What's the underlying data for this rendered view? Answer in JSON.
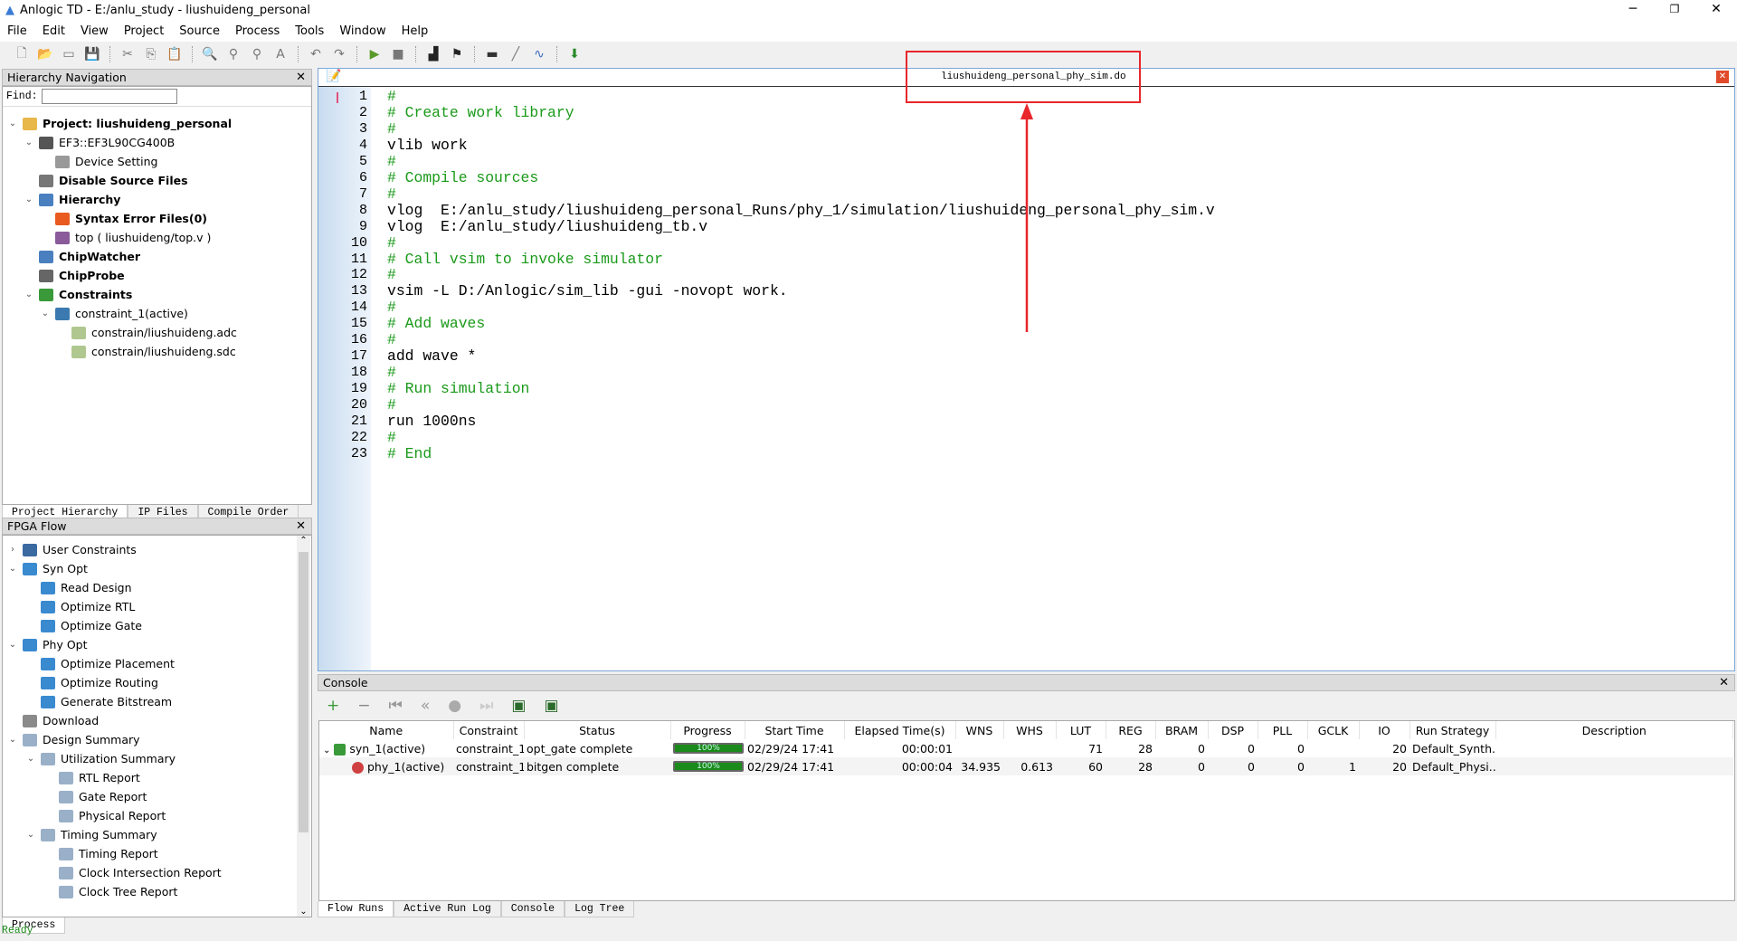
{
  "window": {
    "title": "Anlogic TD - E:/anlu_study - liushuideng_personal",
    "minimize": "─",
    "restore": "❐",
    "close": "✕"
  },
  "menu": [
    "File",
    "Edit",
    "View",
    "Project",
    "Source",
    "Process",
    "Tools",
    "Window",
    "Help"
  ],
  "toolbar": [
    "new-file",
    "open",
    "close",
    "save",
    "cut",
    "copy",
    "paste",
    "find",
    "find-prev",
    "find-next",
    "replace",
    "undo",
    "redo",
    "run",
    "stop",
    "chart",
    "flag",
    "chip",
    "probe",
    "waveform",
    "download"
  ],
  "hierarchy": {
    "title": "Hierarchy Navigation",
    "find_label": "Find:",
    "find_value": "",
    "items": [
      {
        "label": "Project: liushuideng_personal",
        "bold": true,
        "level": 0,
        "caret": "⌄",
        "icon": "project-icon",
        "color": "#e8b84a"
      },
      {
        "label": "EF3::EF3L90CG400B",
        "bold": false,
        "level": 1,
        "caret": "⌄",
        "icon": "chip-icon",
        "color": "#555"
      },
      {
        "label": "Device Setting",
        "bold": false,
        "level": 2,
        "caret": "",
        "icon": "settings-icon",
        "color": "#999"
      },
      {
        "label": "Disable Source Files",
        "bold": true,
        "level": 1,
        "caret": "",
        "icon": "disabled-files-icon",
        "color": "#777"
      },
      {
        "label": "Hierarchy",
        "bold": true,
        "level": 1,
        "caret": "⌄",
        "icon": "hierarchy-icon",
        "color": "#4a7fc0"
      },
      {
        "label": "Syntax Error Files(0)",
        "bold": true,
        "level": 2,
        "caret": "",
        "icon": "error-files-icon",
        "color": "#e85a20"
      },
      {
        "label": "top ( liushuideng/top.v )",
        "bold": false,
        "level": 2,
        "caret": "",
        "icon": "module-icon",
        "color": "#8a5a9a"
      },
      {
        "label": "ChipWatcher",
        "bold": true,
        "level": 1,
        "caret": "",
        "icon": "chipwatcher-icon",
        "color": "#4a7fc0"
      },
      {
        "label": "ChipProbe",
        "bold": true,
        "level": 1,
        "caret": "",
        "icon": "chipprobe-icon",
        "color": "#666"
      },
      {
        "label": "Constraints",
        "bold": true,
        "level": 1,
        "caret": "⌄",
        "icon": "constraints-icon",
        "color": "#3a9a3a"
      },
      {
        "label": "constraint_1(active)",
        "bold": false,
        "level": 2,
        "caret": "⌄",
        "icon": "folder-icon",
        "color": "#3a7ab0"
      },
      {
        "label": "constrain/liushuideng.adc",
        "bold": false,
        "level": 3,
        "caret": "",
        "icon": "file-icon",
        "color": "#b0c890"
      },
      {
        "label": "constrain/liushuideng.sdc",
        "bold": false,
        "level": 3,
        "caret": "",
        "icon": "file-icon",
        "color": "#b0c890"
      }
    ],
    "tabs": [
      "Project Hierarchy",
      "IP Files",
      "Compile Order"
    ]
  },
  "flow": {
    "title": "FPGA Flow",
    "items": [
      {
        "label": "User Constraints",
        "level": 0,
        "caret": "›",
        "icon": "gear-icon",
        "color": "#3a6aa0"
      },
      {
        "label": "Syn Opt",
        "level": 0,
        "caret": "⌄",
        "icon": "database-icon",
        "color": "#3a8ad0"
      },
      {
        "label": "Read Design",
        "level": 1,
        "caret": "",
        "icon": "database-icon",
        "color": "#3a8ad0"
      },
      {
        "label": "Optimize RTL",
        "level": 1,
        "caret": "",
        "icon": "database-icon",
        "color": "#3a8ad0"
      },
      {
        "label": "Optimize Gate",
        "level": 1,
        "caret": "",
        "icon": "database-icon",
        "color": "#3a8ad0"
      },
      {
        "label": "Phy Opt",
        "level": 0,
        "caret": "⌄",
        "icon": "database-icon",
        "color": "#3a8ad0"
      },
      {
        "label": "Optimize Placement",
        "level": 1,
        "caret": "",
        "icon": "database-icon",
        "color": "#3a8ad0"
      },
      {
        "label": "Optimize Routing",
        "level": 1,
        "caret": "",
        "icon": "database-icon",
        "color": "#3a8ad0"
      },
      {
        "label": "Generate Bitstream",
        "level": 1,
        "caret": "",
        "icon": "database-icon",
        "color": "#3a8ad0"
      },
      {
        "label": "Download",
        "level": 0,
        "caret": "",
        "icon": "download-gear-icon",
        "color": "#8a8a8a"
      },
      {
        "label": "Design Summary",
        "level": 0,
        "caret": "⌄",
        "icon": "summary-icon",
        "color": "#9ab0c8"
      },
      {
        "label": "Utilization Summary",
        "level": 1,
        "caret": "⌄",
        "icon": "summary-icon",
        "color": "#9ab0c8"
      },
      {
        "label": "RTL Report",
        "level": 2,
        "caret": "",
        "icon": "report-icon",
        "color": "#9ab0c8"
      },
      {
        "label": "Gate Report",
        "level": 2,
        "caret": "",
        "icon": "report-icon",
        "color": "#9ab0c8"
      },
      {
        "label": "Physical Report",
        "level": 2,
        "caret": "",
        "icon": "report-icon",
        "color": "#9ab0c8"
      },
      {
        "label": "Timing Summary",
        "level": 1,
        "caret": "⌄",
        "icon": "summary-icon",
        "color": "#9ab0c8"
      },
      {
        "label": "Timing Report",
        "level": 2,
        "caret": "",
        "icon": "report-icon",
        "color": "#9ab0c8"
      },
      {
        "label": "Clock Intersection Report",
        "level": 2,
        "caret": "",
        "icon": "report-icon",
        "color": "#9ab0c8"
      },
      {
        "label": "Clock Tree Report",
        "level": 2,
        "caret": "",
        "icon": "report-icon",
        "color": "#9ab0c8"
      }
    ],
    "tabs": [
      "Process"
    ]
  },
  "editor": {
    "tab_title": "liushuideng_personal_phy_sim.do",
    "annotation_color": "#e8262b",
    "lines": [
      "#",
      "# Create work library",
      "#",
      "vlib work",
      "#",
      "# Compile sources",
      "#",
      "vlog  E:/anlu_study/liushuideng_personal_Runs/phy_1/simulation/liushuideng_personal_phy_sim.v",
      "vlog  E:/anlu_study/liushuideng_tb.v",
      "#",
      "# Call vsim to invoke simulator",
      "#",
      "vsim -L D:/Anlogic/sim_lib -gui -novopt work.",
      "#",
      "# Add waves",
      "#",
      "add wave *",
      "#",
      "# Run simulation",
      "#",
      "run 1000ns",
      "#",
      "# End"
    ]
  },
  "console": {
    "title": "Console",
    "columns": [
      "Name",
      "Constraint",
      "Status",
      "Progress",
      "Start Time",
      "Elapsed Time(s)",
      "WNS",
      "WHS",
      "LUT",
      "REG",
      "BRAM",
      "DSP",
      "PLL",
      "GCLK",
      "IO",
      "Run Strategy",
      "Description"
    ],
    "rows": [
      {
        "name": "syn_1(active)",
        "constraint": "constraint_1",
        "status": "opt_gate complete",
        "progress": "100%",
        "start": "02/29/24 17:41",
        "elapsed": "00:00:01",
        "wns": "",
        "whs": "",
        "lut": "71",
        "reg": "28",
        "bram": "0",
        "dsp": "0",
        "pll": "0",
        "gclk": "",
        "io": "20",
        "strategy": "Default_Synth...",
        "description": ""
      },
      {
        "name": "phy_1(active)",
        "constraint": "constraint_1",
        "status": "bitgen complete",
        "progress": "100%",
        "start": "02/29/24 17:41",
        "elapsed": "00:00:04",
        "wns": "34.935",
        "whs": "0.613",
        "lut": "60",
        "reg": "28",
        "bram": "0",
        "dsp": "0",
        "pll": "0",
        "gclk": "1",
        "io": "20",
        "strategy": "Default_Physi...",
        "description": ""
      }
    ],
    "tabs": [
      "Flow Runs",
      "Active Run Log",
      "Console",
      "Log Tree"
    ]
  },
  "status": "Ready"
}
